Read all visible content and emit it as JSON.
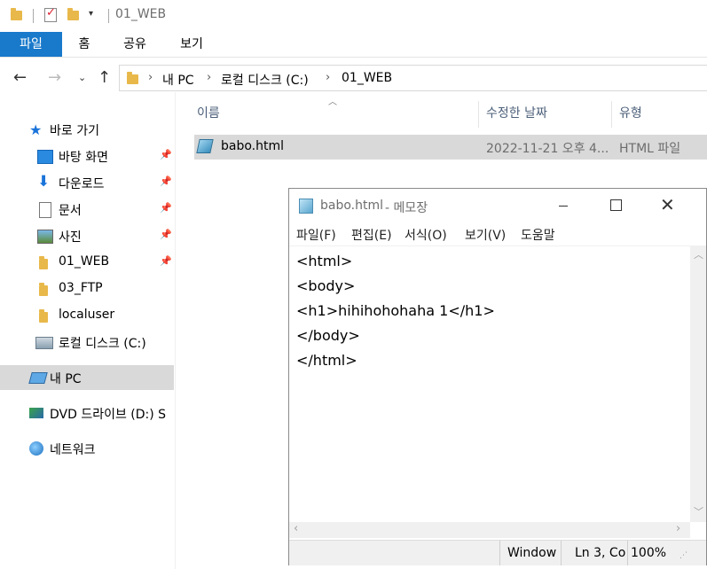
{
  "titlebar": {
    "title": "01_WEB"
  },
  "ribbon": {
    "tabs": [
      "파일",
      "홈",
      "공유",
      "보기"
    ]
  },
  "address": {
    "crumbs": [
      "내 PC",
      "로컬 디스크 (C:)",
      "01_WEB"
    ]
  },
  "nav": {
    "quick_access": "바로 가기",
    "items": [
      "바탕 화면",
      "다운로드",
      "문서",
      "사진",
      "01_WEB",
      "03_FTP",
      "localuser",
      "로컬 디스크 (C:)"
    ],
    "this_pc": "내 PC",
    "dvd": "DVD 드라이브 (D:) S",
    "network": "네트워크"
  },
  "columns": {
    "name": "이름",
    "modified": "수정한 날짜",
    "type": "유형"
  },
  "file": {
    "name": "babo.html",
    "modified": "2022-11-21 오후 4...",
    "type": "HTML 파일"
  },
  "notepad": {
    "title_file": "babo.html",
    "title_app": "- 메모장",
    "menu": [
      "파일(F)",
      "편집(E)",
      "서식(O)",
      "보기(V)",
      "도움말"
    ],
    "content": "<html>\n<body>\n<h1>hihihohohaha 1</h1>\n</body>\n</html>",
    "status": {
      "eol": "Window",
      "position": "Ln 3, Co",
      "zoom": "100%"
    }
  }
}
